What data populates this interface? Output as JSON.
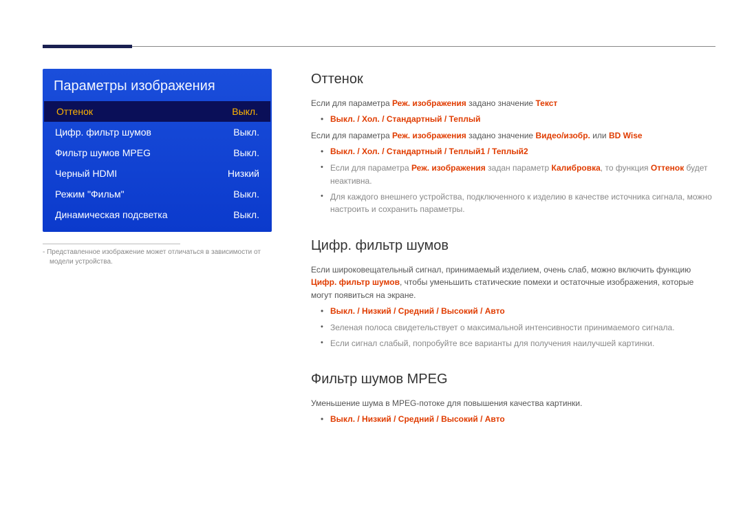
{
  "menu": {
    "title": "Параметры изображения",
    "items": [
      {
        "label": "Оттенок",
        "value": "Выкл.",
        "selected": true
      },
      {
        "label": "Цифр. фильтр шумов",
        "value": "Выкл.",
        "selected": false
      },
      {
        "label": "Фильтр шумов MPEG",
        "value": "Выкл.",
        "selected": false
      },
      {
        "label": "Черный HDMI",
        "value": "Низкий",
        "selected": false
      },
      {
        "label": "Режим \"Фильм\"",
        "value": "Выкл.",
        "selected": false
      },
      {
        "label": "Динамическая подсветка",
        "value": "Выкл.",
        "selected": false
      }
    ]
  },
  "footnote": "Представленное изображение может отличаться в зависимости от модели устройства.",
  "section_tint": {
    "heading": "Оттенок",
    "p1_a": "Если для параметра ",
    "p1_b": "Реж. изображения",
    "p1_c": " задано значение ",
    "p1_d": "Текст",
    "opts1": "Выкл. / Хол. / Стандартный / Теплый",
    "p2_a": "Если для параметра ",
    "p2_b": "Реж. изображения",
    "p2_c": " задано значение ",
    "p2_d": "Видео/изобр.",
    "p2_e": " или ",
    "p2_f": "BD Wise",
    "opts2": "Выкл. / Хол. / Стандартный / Теплый1 / Теплый2",
    "d1_a": "Если для параметра ",
    "d1_b": "Реж. изображения",
    "d1_c": " задан параметр ",
    "d1_d": "Калибровка",
    "d1_e": ", то функция ",
    "d1_f": "Оттенок",
    "d1_g": " будет неактивна.",
    "d2": "Для каждого внешнего устройства, подключенного к изделию в качестве источника сигнала, можно настроить и сохранить параметры."
  },
  "section_dnf": {
    "heading": "Цифр. фильтр шумов",
    "p1_a": "Если широковещательный сигнал, принимаемый изделием, очень слаб, можно включить функцию ",
    "p1_b": "Цифр. фильтр шумов",
    "p1_c": ", чтобы уменьшить статические помехи и остаточные изображения, которые могут появиться на экране.",
    "opts": "Выкл. / Низкий / Средний / Высокий / Авто",
    "d1": "Зеленая полоса свидетельствует о максимальной интенсивности принимаемого сигнала.",
    "d2": "Если сигнал слабый, попробуйте все варианты для получения наилучшей картинки."
  },
  "section_mpeg": {
    "heading": "Фильтр шумов MPEG",
    "p1": "Уменьшение шума в MPEG-потоке для повышения качества картинки.",
    "opts": "Выкл. / Низкий / Средний / Высокий / Авто"
  }
}
